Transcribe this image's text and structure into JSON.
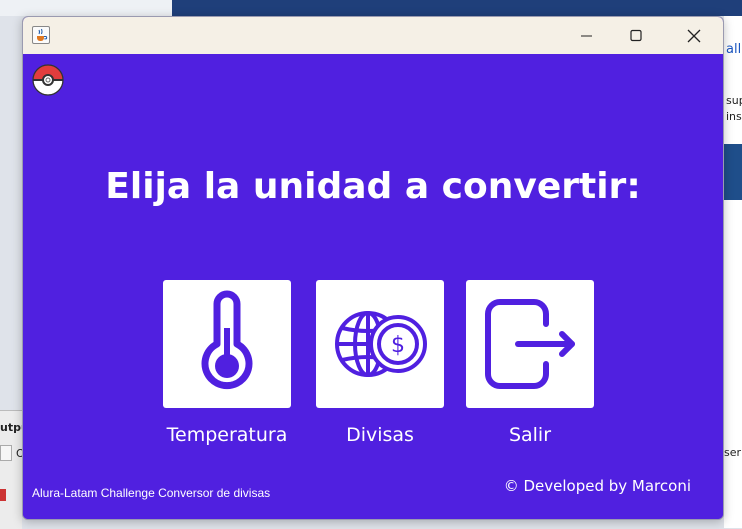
{
  "window": {
    "title": "",
    "icons": {
      "app": "java-cup-icon",
      "minimize": "minimize-icon",
      "maximize": "maximize-icon",
      "close": "close-icon"
    }
  },
  "colors": {
    "background": "#5020e0",
    "tile": "#ffffff",
    "icon": "#5020e0",
    "text": "#ffffff"
  },
  "header": {
    "logo_icon": "pokeball-icon",
    "title": "Elija la unidad a convertir:"
  },
  "options": [
    {
      "label": "Temperatura",
      "icon": "thermometer-icon"
    },
    {
      "label": "Divisas",
      "icon": "globe-currency-icon"
    },
    {
      "label": "Salir",
      "icon": "exit-icon"
    }
  ],
  "footer": {
    "left": "Alura-Latam Challenge Conversor de divisas",
    "right": "© Developed by Marconi"
  },
  "background": {
    "right_link": "all",
    "right_text1": "sup",
    "right_text2": "ins",
    "left_panel": "utpu",
    "left_text": "O",
    "right_text3": "ser"
  }
}
